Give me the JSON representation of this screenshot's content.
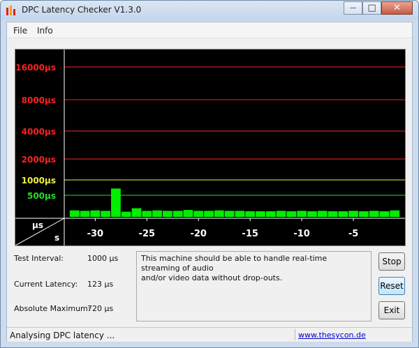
{
  "window": {
    "title": "DPC Latency Checker V1.3.0",
    "minimize_glyph": "—",
    "maximize_glyph": "□",
    "close_glyph": "✕"
  },
  "menu": {
    "items": [
      "File",
      "Info"
    ]
  },
  "chart_data": {
    "type": "bar",
    "title": "",
    "xlabel": "s",
    "ylabel": "µs",
    "y_scale": "log-like (threshold lines)",
    "y_tick_labels": [
      {
        "label": "16000µs",
        "value": 16000,
        "color": "#ff2020"
      },
      {
        "label": "8000µs",
        "value": 8000,
        "color": "#ff2020"
      },
      {
        "label": "4000µs",
        "value": 4000,
        "color": "#ff2020"
      },
      {
        "label": "2000µs",
        "value": 2000,
        "color": "#ff2020"
      },
      {
        "label": "1000µs",
        "value": 1000,
        "color": "#f0f040"
      },
      {
        "label": "500µs",
        "value": 500,
        "color": "#20e020"
      }
    ],
    "x_tick_labels": [
      "-30",
      "-25",
      "-20",
      "-15",
      "-10",
      "-5"
    ],
    "x_ticks": [
      -30,
      -25,
      -20,
      -15,
      -10,
      -5
    ],
    "xlim": [
      -33,
      0
    ],
    "x": [
      -32,
      -31,
      -30,
      -29,
      -28,
      -27,
      -26,
      -25,
      -24,
      -23,
      -22,
      -21,
      -20,
      -19,
      -18,
      -17,
      -16,
      -15,
      -14,
      -13,
      -12,
      -11,
      -10,
      -9,
      -8,
      -7,
      -6,
      -5,
      -4,
      -3,
      -2,
      -1
    ],
    "values": [
      150,
      140,
      150,
      140,
      720,
      120,
      200,
      140,
      150,
      140,
      140,
      160,
      140,
      140,
      150,
      140,
      140,
      130,
      130,
      130,
      140,
      130,
      140,
      130,
      140,
      130,
      130,
      140,
      130,
      140,
      130,
      150
    ],
    "bar_color": "#00ee00",
    "grid": true
  },
  "stats": {
    "test_interval_label": "Test Interval:",
    "test_interval_value": "1000 µs",
    "current_latency_label": "Current Latency:",
    "current_latency_value": "123 µs",
    "absolute_maximum_label": "Absolute Maximum:",
    "absolute_maximum_value": "720 µs"
  },
  "message": {
    "line1": "This machine should be able to handle real-time streaming of audio",
    "line2": "and/or video data without drop-outs."
  },
  "buttons": {
    "stop": "Stop",
    "reset": "Reset",
    "exit": "Exit"
  },
  "status": {
    "text": "Analysing DPC latency ...",
    "link": "www.thesycon.de"
  }
}
